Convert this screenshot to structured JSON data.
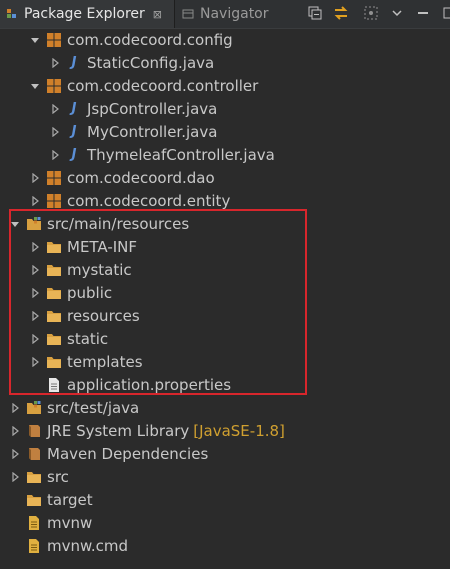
{
  "tabs": {
    "active_label": "Package Explorer",
    "inactive_label": "Navigator",
    "close_glyph": "⊠"
  },
  "tree": [
    {
      "label": "com.codecoord.config",
      "kind": "package",
      "arrow": "down"
    },
    {
      "label": "StaticConfig.java",
      "kind": "java",
      "arrow": "right"
    },
    {
      "label": "com.codecoord.controller",
      "kind": "package",
      "arrow": "down"
    },
    {
      "label": "JspController.java",
      "kind": "java",
      "arrow": "right"
    },
    {
      "label": "MyController.java",
      "kind": "java",
      "arrow": "right"
    },
    {
      "label": "ThymeleafController.java",
      "kind": "java",
      "arrow": "right"
    },
    {
      "label": "com.codecoord.dao",
      "kind": "package",
      "arrow": "right"
    },
    {
      "label": "com.codecoord.entity",
      "kind": "package",
      "arrow": "right"
    },
    {
      "label": "src/main/resources",
      "kind": "source-folder",
      "arrow": "down"
    },
    {
      "label": "META-INF",
      "kind": "folder",
      "arrow": "right"
    },
    {
      "label": "mystatic",
      "kind": "folder",
      "arrow": "right"
    },
    {
      "label": "public",
      "kind": "folder",
      "arrow": "right"
    },
    {
      "label": "resources",
      "kind": "folder",
      "arrow": "right"
    },
    {
      "label": "static",
      "kind": "folder",
      "arrow": "right"
    },
    {
      "label": "templates",
      "kind": "folder",
      "arrow": "right"
    },
    {
      "label": "application.properties",
      "kind": "file",
      "arrow": "none"
    },
    {
      "label": "src/test/java",
      "kind": "source-folder",
      "arrow": "right"
    },
    {
      "label": "JRE System Library",
      "suffix": "[JavaSE-1.8]",
      "kind": "library",
      "arrow": "right"
    },
    {
      "label": "Maven Dependencies",
      "kind": "library",
      "arrow": "right"
    },
    {
      "label": "src",
      "kind": "folder",
      "arrow": "right"
    },
    {
      "label": "target",
      "kind": "folder",
      "arrow": "none"
    },
    {
      "label": "mvnw",
      "kind": "file-yellow",
      "arrow": "none"
    },
    {
      "label": "mvnw.cmd",
      "kind": "file-yellow",
      "arrow": "none"
    }
  ],
  "colors": {
    "background": "#2b2b2b",
    "text": "#c8c8c8",
    "highlight_box": "#d8262c",
    "package_icon": "#d0802a",
    "folder_icon": "#d8a040",
    "java_icon": "#5b8fd6",
    "library_suffix": "#d0a030"
  }
}
